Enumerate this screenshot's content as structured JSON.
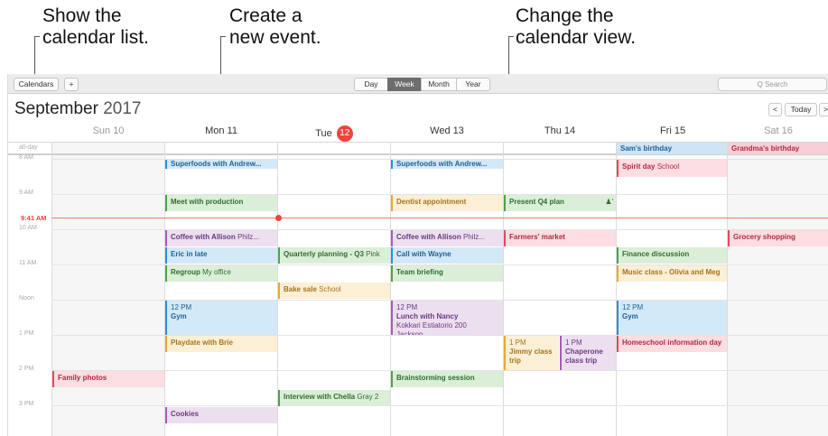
{
  "callouts": {
    "calendar_list": [
      "Show the",
      "calendar list."
    ],
    "new_event": [
      "Create a",
      "new event."
    ],
    "change_view": [
      "Change the",
      "calendar view."
    ]
  },
  "toolbar": {
    "calendars_label": "Calendars",
    "add_label": "+",
    "views": [
      "Day",
      "Week",
      "Month",
      "Year"
    ],
    "active_view": "Week",
    "search_placeholder": "Q Search"
  },
  "header": {
    "month": "September",
    "year": "2017",
    "prev": "<",
    "today": "Today",
    "next": ">"
  },
  "days": [
    {
      "label": "Sun 10",
      "weekend": true
    },
    {
      "label": "Mon 11",
      "weekend": false
    },
    {
      "label": "Tue",
      "num": "12",
      "today": true
    },
    {
      "label": "Wed 13",
      "weekend": false
    },
    {
      "label": "Thu 14",
      "weekend": false
    },
    {
      "label": "Fri 15",
      "weekend": false
    },
    {
      "label": "Sat 16",
      "weekend": true
    }
  ],
  "time_labels": [
    "all-day",
    "8 AM",
    "9 AM",
    "10 AM",
    "11 AM",
    "Noon",
    "1 PM",
    "2 PM",
    "3 PM"
  ],
  "now_label": "9:41 AM",
  "all_day_events": [
    {
      "day": 5,
      "title": "Sam's birthday",
      "color": "blue"
    },
    {
      "day": 6,
      "title": "Grandma's birthday",
      "color": "pink"
    }
  ],
  "events": [
    {
      "title": "Superfoods with Andrew...",
      "color": "blue"
    },
    {
      "title": "Superfoods with Andrew...",
      "color": "blue"
    },
    {
      "title": "Spirit day",
      "loc": "School",
      "color": "pink"
    },
    {
      "title": "Meet with production",
      "color": "green"
    },
    {
      "title": "Dentist appointment",
      "color": "orange"
    },
    {
      "title": "Present Q4 plan",
      "color": "green"
    },
    {
      "title": "Coffee with Allison",
      "loc": "Philz...",
      "color": "purple"
    },
    {
      "title": "Coffee with Allison",
      "loc": "Philz...",
      "color": "purple"
    },
    {
      "title": "Farmers' market",
      "color": "pink"
    },
    {
      "title": "Grocery shopping",
      "color": "pink"
    },
    {
      "title": "Eric in late",
      "color": "blue"
    },
    {
      "title": "Quarterly planning - Q3",
      "loc": "Pink",
      "color": "green"
    },
    {
      "title": "Call with Wayne",
      "color": "blue"
    },
    {
      "title": "Finance discussion",
      "color": "green"
    },
    {
      "title": "Regroup",
      "loc": "My office",
      "color": "green"
    },
    {
      "title": "Team briefing",
      "color": "green"
    },
    {
      "title": "Music class - Olivia and Meg",
      "color": "orange"
    },
    {
      "title": "Bake sale",
      "loc": "School",
      "color": "orange"
    },
    {
      "time": "12 PM",
      "title": "Gym",
      "color": "blue"
    },
    {
      "time": "12 PM",
      "title": "Lunch with Nancy",
      "loc": "Kokkari Estiatorio 200 Jackson...",
      "color": "purple"
    },
    {
      "time": "12 PM",
      "title": "Gym",
      "color": "blue"
    },
    {
      "title": "Playdate with Brie",
      "color": "orange"
    },
    {
      "time": "1 PM",
      "title": "Jimmy class trip",
      "color": "orange"
    },
    {
      "time": "1 PM",
      "title": "Chaperone class trip",
      "color": "purple"
    },
    {
      "title": "Homeschool information day",
      "color": "pink"
    },
    {
      "title": "Family photos",
      "color": "pink"
    },
    {
      "title": "Brainstorming session",
      "color": "green"
    },
    {
      "title": "Interview with Chella",
      "loc": "Gray 2",
      "color": "green"
    },
    {
      "title": "Cookies",
      "color": "purple"
    }
  ]
}
